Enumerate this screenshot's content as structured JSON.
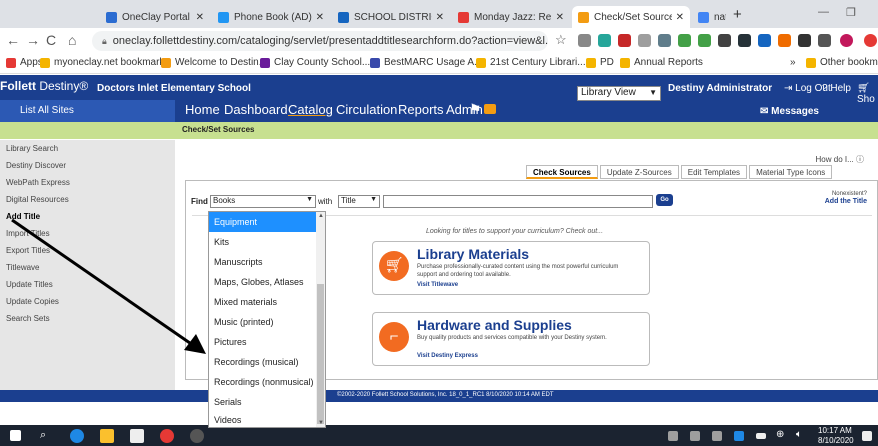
{
  "browser": {
    "tabs": [
      {
        "label": "OneClay Portal",
        "color": "#2b6cd1",
        "active": false
      },
      {
        "label": "Phone Book (AD)",
        "color": "#2196f3",
        "active": false
      },
      {
        "label": "SCHOOL DISTRICT C",
        "color": "#1565c0",
        "active": false
      },
      {
        "label": "Monday Jazz: Re",
        "color": "#e53935",
        "active": false
      },
      {
        "label": "Check/Set Sources",
        "color": "#f39c12",
        "active": true
      },
      {
        "label": "national poetry mon",
        "color": "#4285f4",
        "active": false
      }
    ],
    "url": "oneclay.follettdestiny.com/cataloging/servlet/presentaddtitlesearchform.do?action=view&l...",
    "bookmarks": [
      {
        "label": "Apps",
        "color": "#e53935"
      },
      {
        "label": "myoneclay.net bookmarks",
        "color": "#f4b400"
      },
      {
        "label": "Welcome to Destin...",
        "color": "#f39c12"
      },
      {
        "label": "Clay County School...",
        "color": "#6a1b9a"
      },
      {
        "label": "BestMARC Usage A...",
        "color": "#3949ab"
      },
      {
        "label": "21st Century Librari...",
        "color": "#f4b400"
      },
      {
        "label": "PD",
        "color": "#f4b400"
      },
      {
        "label": "Annual Reports",
        "color": "#f4b400"
      }
    ],
    "bookmarks_more": "»",
    "other_bookmarks": "Other bookmarks"
  },
  "header": {
    "brand_bold": "Follett",
    "brand_thin": "Destiny",
    "brand_mark": "®",
    "school": "Doctors Inlet Elementary School",
    "library_view": "Library View",
    "admin": "Destiny Administrator",
    "logout": "Log Out",
    "help": "Help",
    "shop": "Sho",
    "list_all": "List All Sites",
    "nav": [
      "Home",
      "Dashboard",
      "Catalog",
      "Circulation",
      "Reports",
      "Admin"
    ],
    "messages": "Messages",
    "subbar_crumb": "Check/Set Sources"
  },
  "sidebar": {
    "items": [
      "Library Search",
      "Destiny Discover",
      "WebPath Express",
      "Digital Resources",
      "Add Title",
      "Import Titles",
      "Export Titles",
      "Titlewave",
      "Update Titles",
      "Update Copies",
      "Search Sets"
    ]
  },
  "main": {
    "howdo": "How do I...",
    "tabs": [
      "Check Sources",
      "Update Z-Sources",
      "Edit Templates",
      "Material Type Icons"
    ],
    "find_label": "Find",
    "find_select": "Books",
    "with_label": "with",
    "with_select": "Title",
    "go": "Go",
    "nonexistent": "Nonexistent?",
    "add_title": "Add the Title",
    "looking": "Looking for titles to support your curriculum? Check out...",
    "promo1": {
      "title": "Library Materials",
      "desc": "Purchase professionally-curated content using the most powerful curriculum support and ordering tool available.",
      "link": "Visit Titlewave"
    },
    "promo2": {
      "title": "Hardware and Supplies",
      "desc": "Buy quality products and services compatible with your Destiny system.",
      "link": "Visit Destiny Express"
    }
  },
  "dropdown": {
    "items": [
      "Equipment",
      "Kits",
      "Manuscripts",
      "Maps, Globes, Atlases",
      "Mixed materials",
      "Music (printed)",
      "Pictures",
      "Recordings (musical)",
      "Recordings (nonmusical)",
      "Serials",
      "Videos"
    ],
    "highlighted": "Equipment"
  },
  "footer": {
    "text": "©2002-2020 Follett School Solutions, Inc.   18_0_1_RC1   8/10/2020 10:14 AM EDT"
  },
  "taskbar": {
    "time": "10:17 AM",
    "date": "8/10/2020"
  }
}
